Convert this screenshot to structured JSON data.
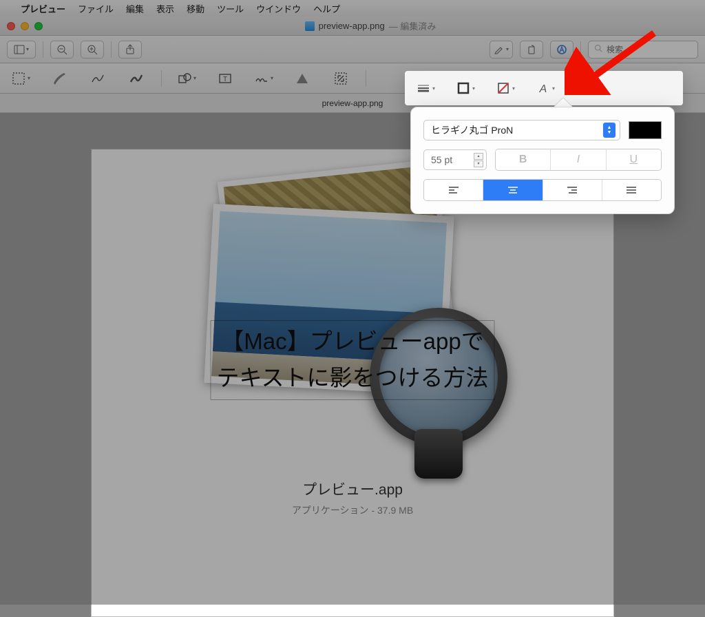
{
  "menubar": {
    "app": "プレビュー",
    "items": [
      "ファイル",
      "編集",
      "表示",
      "移動",
      "ツール",
      "ウインドウ",
      "ヘルプ"
    ]
  },
  "titlebar": {
    "filename": "preview-app.png",
    "status": "— 編集済み"
  },
  "toolbar": {
    "search_placeholder": "検索"
  },
  "tab": {
    "label": "preview-app.png"
  },
  "canvas": {
    "text_line1": "【Mac】プレビューappで",
    "text_line2": "テキストに影をつける方法",
    "caption_name": "プレビュー.app",
    "caption_meta_type": "アプリケーション",
    "caption_meta_size": "37.9 MB"
  },
  "popover": {
    "font_name": "ヒラギノ丸ゴ ProN",
    "font_size": "55 pt",
    "color": "#000000",
    "bold": "B",
    "italic": "I",
    "underline": "U",
    "align_active": "center"
  }
}
